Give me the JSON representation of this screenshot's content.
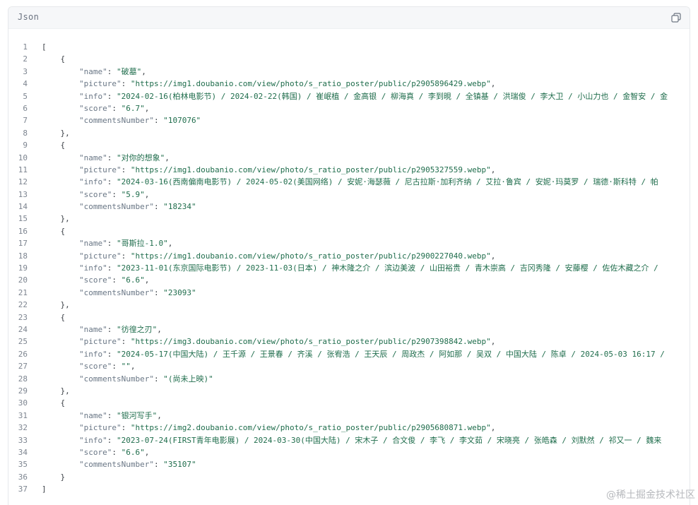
{
  "header": {
    "language_label": "Json"
  },
  "code": {
    "lines": [
      {
        "n": "1",
        "indent": 0,
        "text": "["
      },
      {
        "n": "2",
        "indent": 1,
        "text": "{"
      },
      {
        "n": "3",
        "indent": 2,
        "key": "\"name\"",
        "value": "\"破墓\"",
        "trail": ","
      },
      {
        "n": "4",
        "indent": 2,
        "key": "\"picture\"",
        "value": "\"https://img1.doubanio.com/view/photo/s_ratio_poster/public/p2905896429.webp\"",
        "trail": ","
      },
      {
        "n": "5",
        "indent": 2,
        "key": "\"info\"",
        "value": "\"2024-02-16(柏林电影节) / 2024-02-22(韩国) / 崔岷植 / 金高银 / 柳海真 / 李到晛 / 全镇基 / 洪瑞俊 / 李大卫 / 小山力也 / 金智安 / 金",
        "trail": ""
      },
      {
        "n": "6",
        "indent": 2,
        "key": "\"score\"",
        "value": "\"6.7\"",
        "trail": ","
      },
      {
        "n": "7",
        "indent": 2,
        "key": "\"commentsNumber\"",
        "value": "\"107076\"",
        "trail": ""
      },
      {
        "n": "8",
        "indent": 1,
        "text": "},"
      },
      {
        "n": "9",
        "indent": 1,
        "text": "{"
      },
      {
        "n": "10",
        "indent": 2,
        "key": "\"name\"",
        "value": "\"对你的想象\"",
        "trail": ","
      },
      {
        "n": "11",
        "indent": 2,
        "key": "\"picture\"",
        "value": "\"https://img1.doubanio.com/view/photo/s_ratio_poster/public/p2905327559.webp\"",
        "trail": ","
      },
      {
        "n": "12",
        "indent": 2,
        "key": "\"info\"",
        "value": "\"2024-03-16(西南偏南电影节) / 2024-05-02(美国网络) / 安妮·海瑟薇 / 尼古拉斯·加利齐纳 / 艾拉·鲁宾 / 安妮·玛莫罗 / 瑞德·斯科特 / 帕",
        "trail": ""
      },
      {
        "n": "13",
        "indent": 2,
        "key": "\"score\"",
        "value": "\"5.9\"",
        "trail": ","
      },
      {
        "n": "14",
        "indent": 2,
        "key": "\"commentsNumber\"",
        "value": "\"18234\"",
        "trail": ""
      },
      {
        "n": "15",
        "indent": 1,
        "text": "},"
      },
      {
        "n": "16",
        "indent": 1,
        "text": "{"
      },
      {
        "n": "17",
        "indent": 2,
        "key": "\"name\"",
        "value": "\"哥斯拉-1.0\"",
        "trail": ","
      },
      {
        "n": "18",
        "indent": 2,
        "key": "\"picture\"",
        "value": "\"https://img1.doubanio.com/view/photo/s_ratio_poster/public/p2900227040.webp\"",
        "trail": ","
      },
      {
        "n": "19",
        "indent": 2,
        "key": "\"info\"",
        "value": "\"2023-11-01(东京国际电影节) / 2023-11-03(日本) / 神木隆之介 / 滨边美波 / 山田裕贵 / 青木崇高 / 吉冈秀隆 / 安藤樱 / 佐佐木藏之介 /",
        "trail": ""
      },
      {
        "n": "20",
        "indent": 2,
        "key": "\"score\"",
        "value": "\"6.6\"",
        "trail": ","
      },
      {
        "n": "21",
        "indent": 2,
        "key": "\"commentsNumber\"",
        "value": "\"23093\"",
        "trail": ""
      },
      {
        "n": "22",
        "indent": 1,
        "text": "},"
      },
      {
        "n": "23",
        "indent": 1,
        "text": "{"
      },
      {
        "n": "24",
        "indent": 2,
        "key": "\"name\"",
        "value": "\"彷徨之刃\"",
        "trail": ","
      },
      {
        "n": "25",
        "indent": 2,
        "key": "\"picture\"",
        "value": "\"https://img3.doubanio.com/view/photo/s_ratio_poster/public/p2907398842.webp\"",
        "trail": ","
      },
      {
        "n": "26",
        "indent": 2,
        "key": "\"info\"",
        "value": "\"2024-05-17(中国大陆) / 王千源 / 王景春 / 齐溪 / 张宥浩 / 王天辰 / 周政杰 / 阿如那 / 吴双 / 中国大陆 / 陈卓 / 2024-05-03 16:17 /",
        "trail": ""
      },
      {
        "n": "27",
        "indent": 2,
        "key": "\"score\"",
        "value": "\"\"",
        "trail": ","
      },
      {
        "n": "28",
        "indent": 2,
        "key": "\"commentsNumber\"",
        "value": "\"(尚未上映)\"",
        "trail": ""
      },
      {
        "n": "29",
        "indent": 1,
        "text": "},"
      },
      {
        "n": "30",
        "indent": 1,
        "text": "{"
      },
      {
        "n": "31",
        "indent": 2,
        "key": "\"name\"",
        "value": "\"银河写手\"",
        "trail": ","
      },
      {
        "n": "32",
        "indent": 2,
        "key": "\"picture\"",
        "value": "\"https://img2.doubanio.com/view/photo/s_ratio_poster/public/p2905680871.webp\"",
        "trail": ","
      },
      {
        "n": "33",
        "indent": 2,
        "key": "\"info\"",
        "value": "\"2023-07-24(FIRST青年电影展) / 2024-03-30(中国大陆) / 宋木子 / 合文俊 / 李飞 / 李文茹 / 宋晓亮 / 张皓森 / 刘默然 / 祁又一 / 魏来",
        "trail": ""
      },
      {
        "n": "34",
        "indent": 2,
        "key": "\"score\"",
        "value": "\"6.6\"",
        "trail": ","
      },
      {
        "n": "35",
        "indent": 2,
        "key": "\"commentsNumber\"",
        "value": "\"35107\"",
        "trail": ""
      },
      {
        "n": "36",
        "indent": 1,
        "text": "}"
      },
      {
        "n": "37",
        "indent": 0,
        "text": "]"
      }
    ]
  },
  "watermark": "@稀土掘金技术社区",
  "icons": {
    "copy": "copy-icon"
  }
}
